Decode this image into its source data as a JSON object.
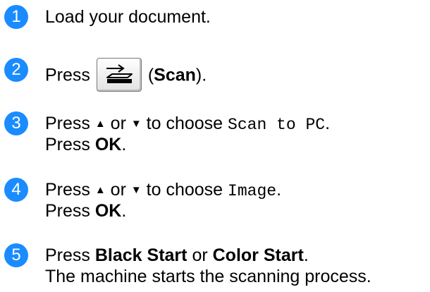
{
  "steps": [
    {
      "number": "1",
      "text": "Load your document."
    },
    {
      "number": "2",
      "press": "Press",
      "paren_open": "(",
      "scan_label": "Scan",
      "paren_close": ").",
      "button_icon": "scan-icon"
    },
    {
      "number": "3",
      "press": "Press",
      "up_arrow": "▲",
      "or": "or",
      "down_arrow": "▼",
      "to_choose": "to choose",
      "option": "Scan to PC",
      "period": ".",
      "press2": "Press",
      "ok": "OK",
      "period2": "."
    },
    {
      "number": "4",
      "press": "Press",
      "up_arrow": "▲",
      "or": "or",
      "down_arrow": "▼",
      "to_choose": "to choose",
      "option": "Image",
      "period": ".",
      "press2": "Press",
      "ok": "OK",
      "period2": "."
    },
    {
      "number": "5",
      "press": "Press",
      "black_start": "Black Start",
      "or": "or",
      "color_start": "Color Start",
      "period": ".",
      "line2": "The machine starts the scanning process."
    }
  ],
  "colors": {
    "badge": "#1a8cff",
    "text": "#000000"
  }
}
